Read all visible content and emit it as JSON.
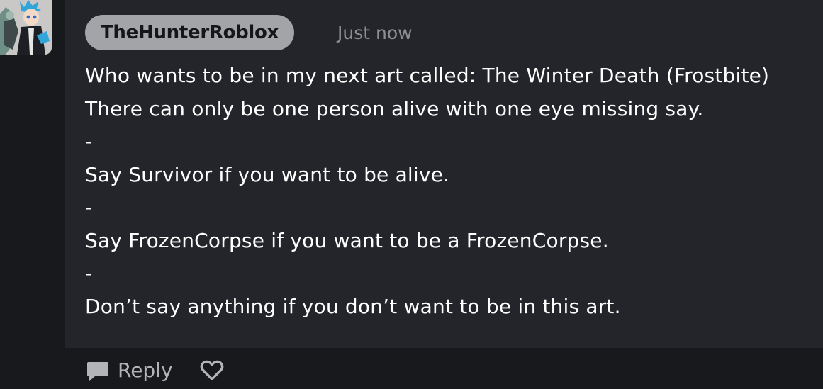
{
  "comment": {
    "username": "TheHunterRoblox",
    "timestamp": "Just now",
    "lines": [
      "Who wants to be in my next art called: The Winter Death (Frostbite)",
      "There can only be one person alive with one eye missing say.",
      "-",
      "Say Survivor if you want to be alive.",
      "-",
      "Say FrozenCorpse if you want to be a FrozenCorpse.",
      "-",
      "Don’t say anything if you don’t want to be in this art."
    ]
  },
  "actions": {
    "reply_label": "Reply",
    "reply_icon": "speech-bubble-icon",
    "like_icon": "heart-outline-icon"
  },
  "colors": {
    "page_background": "#18191d",
    "card_background": "#23252b",
    "username_pill": "#a3a4a8",
    "timestamp_text": "#8d8e93",
    "action_text": "#b3b4b8"
  }
}
